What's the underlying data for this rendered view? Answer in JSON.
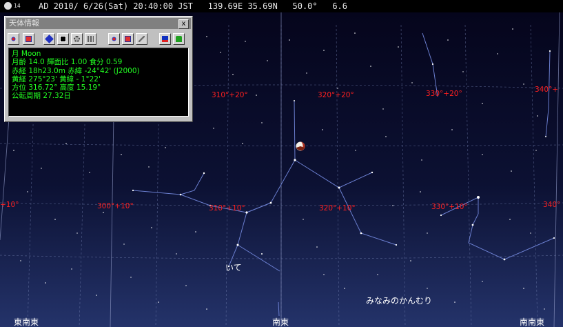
{
  "statusbar": {
    "moon_age_icon": "14",
    "datetime": "AD 2010/ 6/26(Sat) 20:40:00 JST",
    "location": "139.69E 35.69N",
    "fov": "50.0°",
    "magnitude_limit": "6.6"
  },
  "panel": {
    "title": "天体情報",
    "close_label": "x",
    "toolbar_icons": [
      "crosshair-icon",
      "target-icon",
      "diamond-icon",
      "image-icon",
      "gear-icon",
      "grid-icon",
      "crosshair-icon",
      "target-icon",
      "pencil-icon",
      "flag-icon",
      "lock-icon"
    ],
    "lines": {
      "name": "月 Moon",
      "age": "月齢 14.0 輝面比 1.00 食分 0.59",
      "radec": "赤経 18h23.0m  赤緯 -24°42' (J2000)",
      "ecliptic": "黄経 275°23'  黄緯 - 1°22'",
      "altaz": "方位 316.72° 高度 15.19°",
      "period": "公転周期 27.32日"
    }
  },
  "grid_labels_upper": [
    "310°+20°",
    "320°+20°",
    "330°+20°",
    "340°+"
  ],
  "grid_labels_lower": [
    "+10°",
    "300°+10°",
    "310°+10°",
    "320°+10°",
    "330°+10°",
    "340°"
  ],
  "constellations": {
    "sagittarius": "いて",
    "corona_australis": "みなみのかんむり"
  },
  "horizon": {
    "left": "東南東",
    "center": "南東",
    "right": "南南東"
  },
  "colors": {
    "grid_label": "#ff2020",
    "panel_text": "#22ff22",
    "sky_top": "#0a0a2a",
    "sky_bottom": "#1a2a5a"
  }
}
